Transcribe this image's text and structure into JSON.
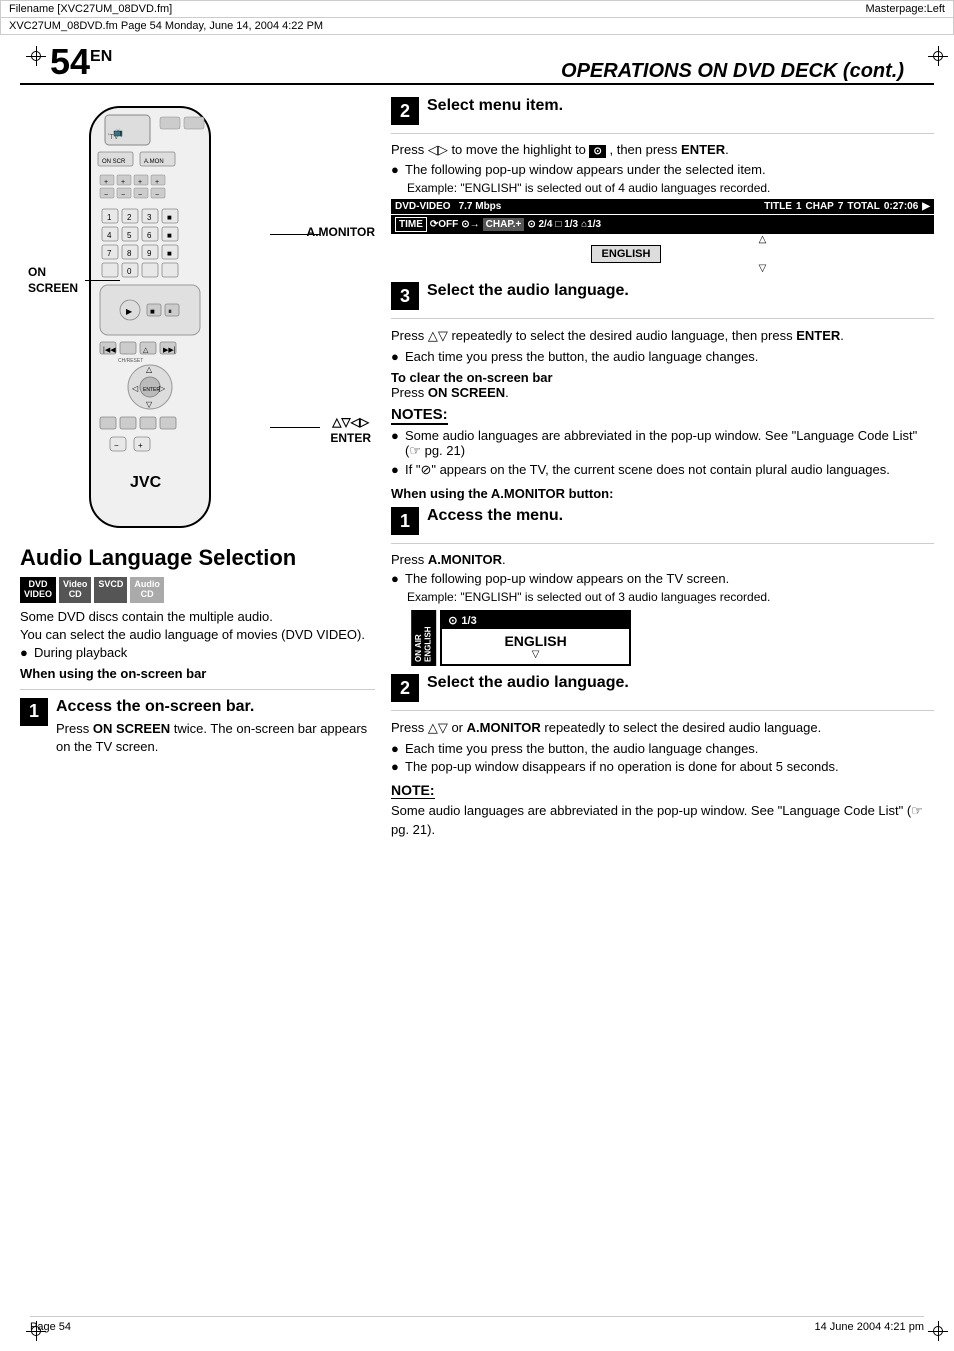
{
  "file_bar": {
    "left": "Filename [XVC27UM_08DVD.fm]",
    "right": "Masterpage:Left"
  },
  "sub_bar": {
    "text": "XVC27UM_08DVD.fm  Page 54  Monday, June 14, 2004  4:22 PM"
  },
  "page": {
    "number": "54",
    "sup": "EN",
    "title": "OPERATIONS ON DVD DECK (cont.)"
  },
  "remote_labels": {
    "a_monitor": "A.MONITOR",
    "on_screen": "ON\nSCREEN",
    "enter": "▽△◁▷\nENTER"
  },
  "section": {
    "title": "Audio Language Selection",
    "badges": [
      {
        "id": "dvd",
        "line1": "DVD",
        "line2": "VIDEO",
        "style": "black"
      },
      {
        "id": "video",
        "line1": "Video",
        "line2": "CD",
        "style": "dark"
      },
      {
        "id": "svcd",
        "line1": "SVCD",
        "line2": "",
        "style": "dark"
      },
      {
        "id": "audio",
        "line1": "Audio",
        "line2": "CD",
        "style": "medium"
      }
    ],
    "intro": [
      "Some DVD discs contain the multiple audio.",
      "You can select the audio language of movies (DVD VIDEO).",
      "● During playback"
    ],
    "when_onscreen_heading": "When using the on-screen bar"
  },
  "steps_left": [
    {
      "num": "1",
      "title": "Access the on-screen bar.",
      "body": "Press ON SCREEN twice. The on-screen bar appears on the TV screen."
    }
  ],
  "right_col": {
    "step2_title": "Select menu item.",
    "step2_body1": "Press ◁▷ to move the highlight to",
    "step2_body2": ", then press ENTER.",
    "step2_bullet": "The following pop-up window appears under the selected item.",
    "step2_example": "Example: \"ENGLISH\" is selected out of 4 audio languages recorded.",
    "onscreen_bar": {
      "dvd_video": "DVD-VIDEO",
      "bitrate": "7.7 Mbps",
      "title_label": "TITLE",
      "title_val": "1",
      "chap_label": "CHAP",
      "chap_val": "7",
      "total_label": "TOTAL",
      "total_val": "0:27:06",
      "arrow": "▶",
      "row2": [
        {
          "text": "TIME"
        },
        {
          "text": "⟳OFF"
        },
        {
          "text": "⊙→"
        },
        {
          "text": "CHAP.▶",
          "highlight": true
        },
        {
          "text": "⊙ 2/4"
        },
        {
          "text": "□ 1/3"
        },
        {
          "text": "⌂1/3"
        }
      ],
      "popup_item": "ENGLISH",
      "popup_arrow_up": "△",
      "popup_arrow_down": "▽"
    },
    "step3_title": "Select the audio language.",
    "step3_body": "Press △▽ repeatedly to select the desired audio language, then press ENTER.",
    "step3_bullet": "Each time you press the button, the audio language changes.",
    "to_clear_heading": "To clear the on-screen bar",
    "to_clear_body": "Press ON SCREEN.",
    "notes_title": "NOTES:",
    "notes": [
      "Some audio languages are abbreviated in the pop-up window. See \"Language Code List\" (☞ pg. 21)",
      "If \"⊘\" appears on the TV, the current scene does not contain plural audio languages."
    ],
    "when_amonitor_heading": "When using the A.MONITOR button:",
    "step1b_title": "Access the menu.",
    "step1b_body": "Press A.MONITOR.",
    "step1b_bullet": "The following pop-up window appears on the TV screen.",
    "step1b_example": "Example: \"ENGLISH\" is selected out of 3 audio languages recorded.",
    "popup_am": {
      "left_text": "ON AIR\nENGLISH",
      "top": "⊙ 1/3",
      "body": "ENGLISH",
      "arrow_up": "△",
      "arrow_down": "▽"
    },
    "step2b_title": "Select the audio language.",
    "step2b_body": "Press △▽ or A.MONITOR repeatedly to select the desired audio language.",
    "step2b_bullets": [
      "Each time you press the button, the audio language changes.",
      "The pop-up window disappears if no operation is done for about 5 seconds."
    ],
    "note_title": "NOTE:",
    "note_body": "Some audio languages are abbreviated in the pop-up window. See \"Language Code List\" (☞ pg. 21)."
  },
  "footer": {
    "left": "Page 54",
    "right": "14 June 2004  4:21 pm"
  }
}
